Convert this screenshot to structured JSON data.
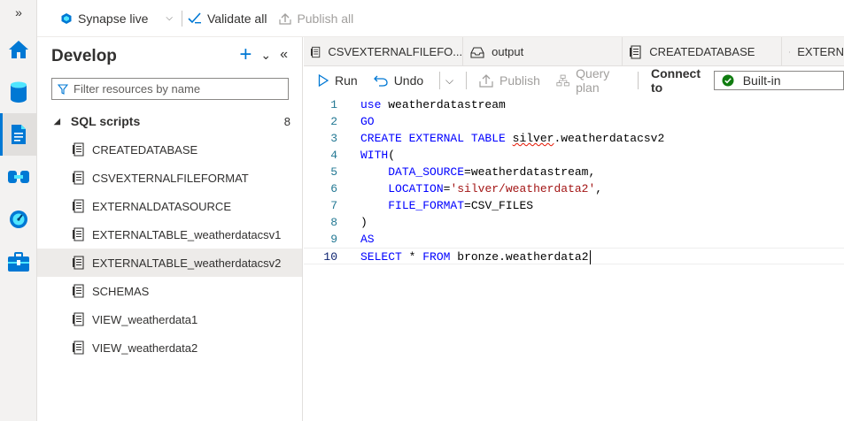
{
  "topbar": {
    "live_mode_label": "Synapse live",
    "validate_all_label": "Validate all",
    "publish_all_label": "Publish all"
  },
  "rail": {
    "items": [
      "home-icon",
      "data-icon",
      "develop-icon",
      "integrate-icon",
      "monitor-icon",
      "manage-icon"
    ]
  },
  "develop": {
    "title": "Develop",
    "filter_placeholder": "Filter resources by name",
    "section_label": "SQL scripts",
    "section_count": "8",
    "scripts": [
      "CREATEDATABASE",
      "CSVEXTERNALFILEFORMAT",
      "EXTERNALDATASOURCE",
      "EXTERNALTABLE_weatherdatacsv1",
      "EXTERNALTABLE_weatherdatacsv2",
      "SCHEMAS",
      "VIEW_weatherdata1",
      "VIEW_weatherdata2"
    ],
    "selected_script": "EXTERNALTABLE_weatherdatacsv2"
  },
  "tabs": [
    {
      "label": "CSVEXTERNALFILEFO...",
      "icon": "script-icon"
    },
    {
      "label": "output",
      "icon": "database-icon"
    },
    {
      "label": "CREATEDATABASE",
      "icon": "script-icon"
    },
    {
      "label": "EXTERN",
      "icon": "script-icon"
    }
  ],
  "toolbar": {
    "run_label": "Run",
    "undo_label": "Undo",
    "publish_label": "Publish",
    "query_plan_label": "Query plan",
    "connect_to_label": "Connect to",
    "connection_value": "Built-in"
  },
  "editor": {
    "line_numbers": [
      "1",
      "2",
      "3",
      "4",
      "5",
      "6",
      "7",
      "8",
      "9",
      "10"
    ],
    "current_line": 10
  },
  "colors": {
    "accent": "#0078d4",
    "keyword": "#0000ff",
    "string": "#a31515",
    "line_number": "#237893",
    "success": "#107c10"
  }
}
